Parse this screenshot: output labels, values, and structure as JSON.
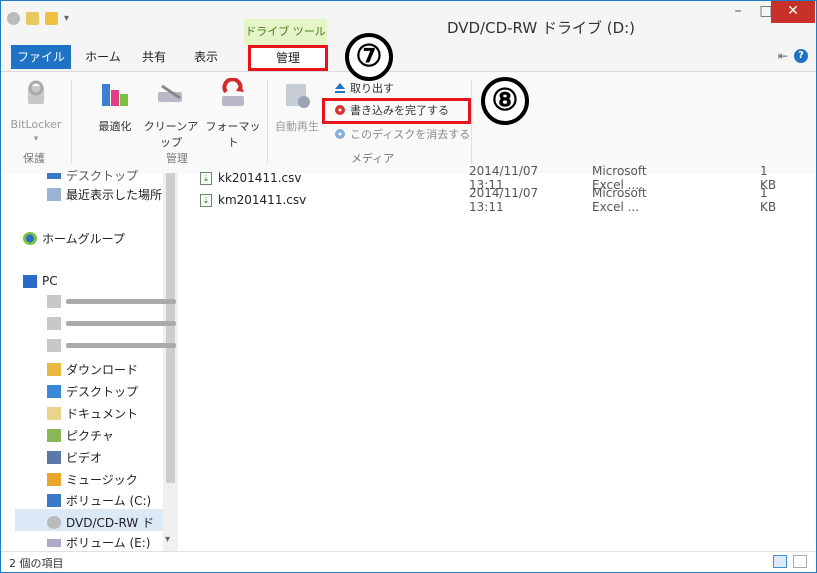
{
  "window": {
    "title": "DVD/CD-RW ドライブ (D:)",
    "context_tab_label": "ドライブ ツール",
    "minimize": "–",
    "maximize": "□",
    "close": "✕"
  },
  "tabs": {
    "file": "ファイル",
    "home": "ホーム",
    "share": "共有",
    "view": "表示",
    "manage": "管理",
    "help": "?"
  },
  "ribbon": {
    "groups": {
      "protect": "保護",
      "manage": "管理",
      "media": "メディア"
    },
    "buttons": {
      "bitlocker": "BitLocker",
      "optimize": "最適化",
      "cleanup": "クリーンアップ",
      "format": "フォーマット",
      "autoplay": "自動再生",
      "eject": "取り出す",
      "finish_burning": "書き込みを完了する",
      "erase_disc": "このディスクを消去する"
    }
  },
  "callouts": {
    "seven": "⑦",
    "eight": "⑧"
  },
  "nav": {
    "desktop_partial": "デスクトップ",
    "recent": "最近表示した場所",
    "homegroup": "ホームグループ",
    "pc": "PC",
    "downloads": "ダウンロード",
    "desktop": "デスクトップ",
    "documents": "ドキュメント",
    "pictures": "ピクチャ",
    "videos": "ビデオ",
    "music": "ミュージック",
    "volume_c": "ボリューム (C:)",
    "dvd": "DVD/CD-RW ド",
    "volume_e": "ボリューム (E:)"
  },
  "files": [
    {
      "name": "kk201411.csv",
      "date": "2014/11/07 13:11",
      "type": "Microsoft Excel ...",
      "size": "1 KB"
    },
    {
      "name": "km201411.csv",
      "date": "2014/11/07 13:11",
      "type": "Microsoft Excel ...",
      "size": "1 KB"
    }
  ],
  "status": {
    "item_count": "2 個の項目"
  },
  "colors": {
    "accent": "#1e73c4",
    "highlight_red": "#e8141c",
    "context_tab_green": "#e6f5c8",
    "close_red": "#c7312a"
  }
}
